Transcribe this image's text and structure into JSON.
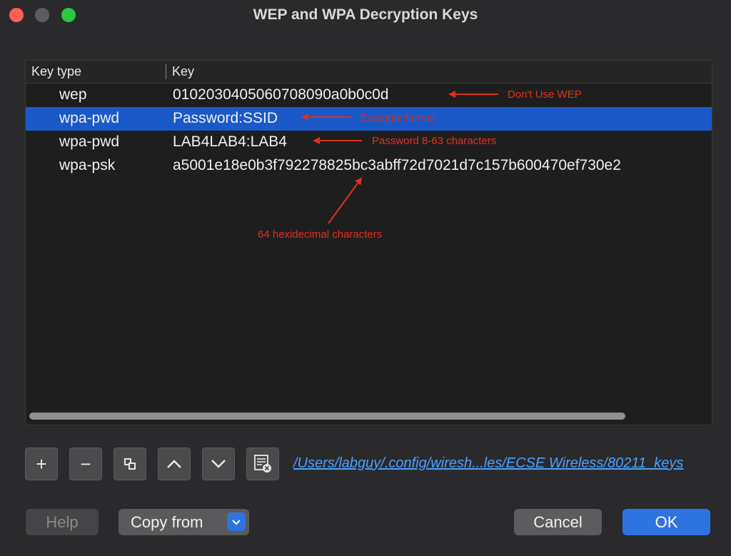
{
  "window": {
    "title": "WEP and WPA Decryption Keys"
  },
  "table": {
    "headers": {
      "key_type": "Key type",
      "key": "Key"
    },
    "rows": [
      {
        "type": "wep",
        "key": "0102030405060708090a0b0c0d",
        "selected": false
      },
      {
        "type": "wpa-pwd",
        "key": "Password:SSID",
        "selected": true
      },
      {
        "type": "wpa-pwd",
        "key": "LAB4LAB4:LAB4",
        "selected": false
      },
      {
        "type": "wpa-psk",
        "key": "a5001e18e0b3f792278825bc3abff72d7021d7c157b600470ef730e2",
        "selected": false
      }
    ]
  },
  "annotations": {
    "wep_note": "Don't Use WEP",
    "format_note": "Example format",
    "password_note": "Password 8-63 characters",
    "hex_note": "64 hexidecimal characters",
    "color": "#e0301e"
  },
  "toolbar": {
    "add": "+",
    "remove": "−",
    "copy_icon": "copy-icon",
    "up_icon": "chevron-up-icon",
    "down_icon": "chevron-down-icon",
    "clear_icon": "clear-list-icon",
    "file_path": "/Users/labguy/.config/wiresh...les/ECSE Wireless/80211_keys"
  },
  "buttons": {
    "help": "Help",
    "copy_from": "Copy from",
    "cancel": "Cancel",
    "ok": "OK"
  },
  "colors": {
    "selection": "#1b59c8",
    "accent": "#2f73e0",
    "link": "#4aa0ff"
  }
}
